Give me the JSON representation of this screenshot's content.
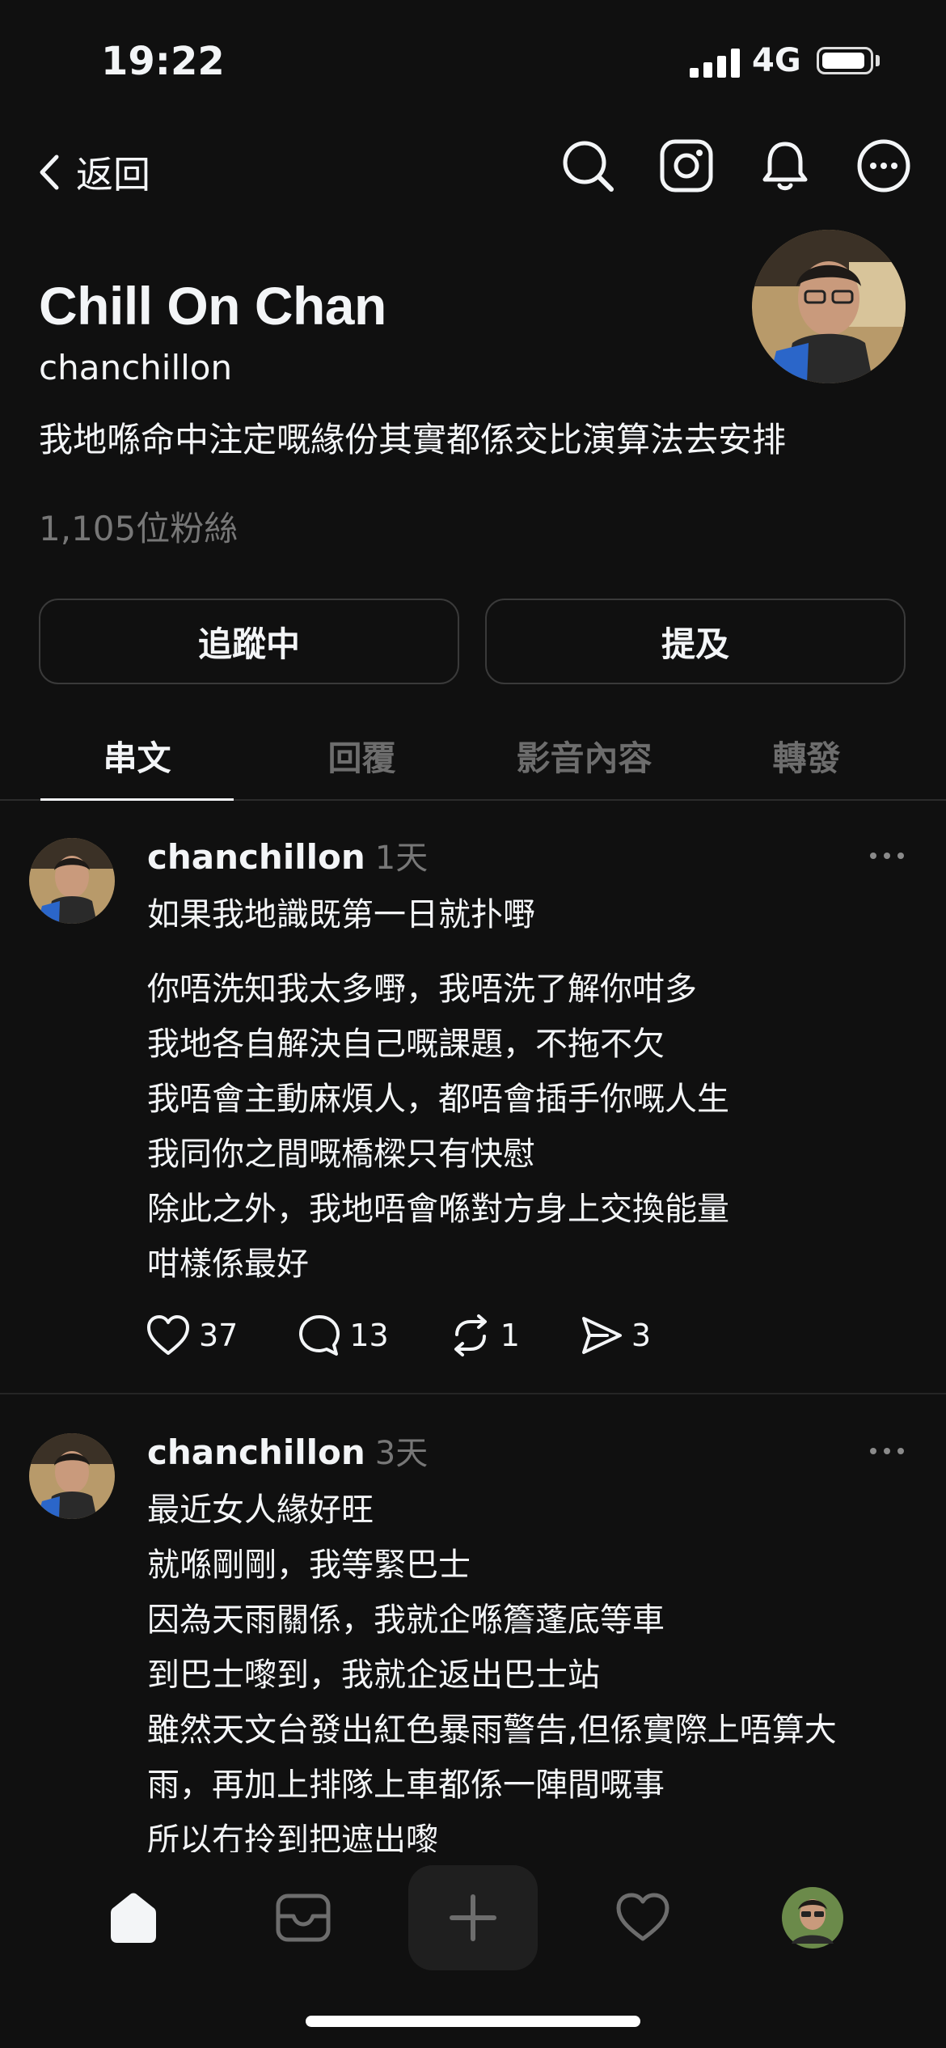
{
  "status_bar": {
    "time": "19:22",
    "network": "4G"
  },
  "nav": {
    "back_label": "返回"
  },
  "profile": {
    "name": "Chill On Chan",
    "handle": "chanchillon",
    "bio": "我地喺命中注定嘅緣份其實都係交比演算法去安排",
    "followers": "1,105位粉絲"
  },
  "buttons": {
    "following": "追蹤中",
    "mention": "提及"
  },
  "tabs": [
    "串文",
    "回覆",
    "影音內容",
    "轉發"
  ],
  "posts": [
    {
      "user": "chanchillon",
      "time": "1天",
      "lines": [
        "如果我地識既第一日就扑嘢",
        "你唔洗知我太多嘢，我唔洗了解你咁多",
        "我地各自解決自己嘅課題，不拖不欠",
        "我唔會主動麻煩人，都唔會插手你嘅人生",
        "我同你之間嘅橋樑只有快慰",
        "除此之外，我地唔會喺對方身上交換能量",
        "咁樣係最好"
      ],
      "likes": "37",
      "comments": "13",
      "reposts": "1",
      "shares": "3"
    },
    {
      "user": "chanchillon",
      "time": "3天",
      "lines": [
        "最近女人緣好旺",
        "就喺剛剛，我等緊巴士",
        "因為天雨關係，我就企喺簷蓬底等車",
        "到巴士嚟到，我就企返出巴士站",
        "雖然天文台發出紅色暴雨警告,但係實際上唔算大",
        "雨，再加上排隊上車都係一陣間嘅事",
        "所以冇拎到把遮出嚟"
      ]
    }
  ],
  "colors": {
    "background": "#101010",
    "text": "#f3f5f7",
    "muted": "#777777",
    "border": "#3a3a3a"
  }
}
